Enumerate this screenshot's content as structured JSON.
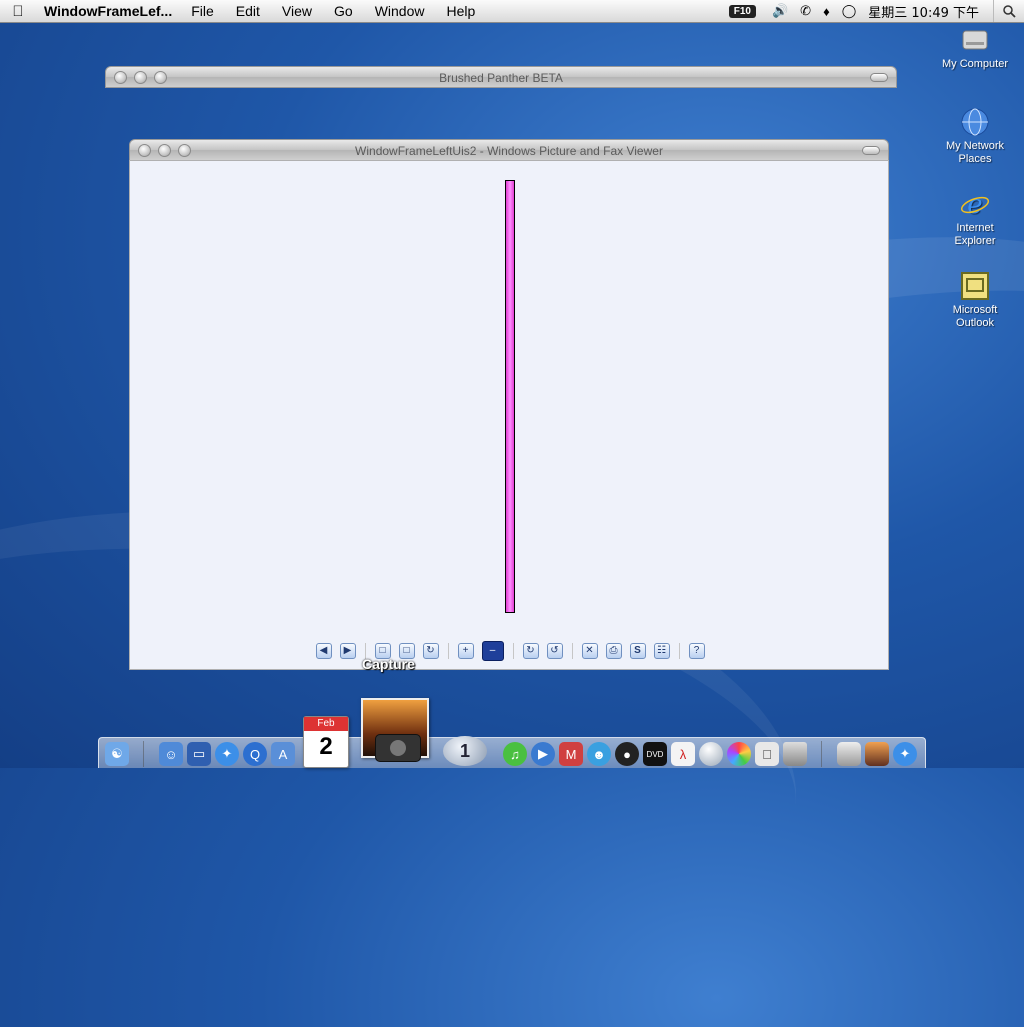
{
  "menubar": {
    "app_name": "WindowFrameLef...",
    "items": [
      "File",
      "Edit",
      "View",
      "Go",
      "Window",
      "Help"
    ],
    "f10_badge": "F10",
    "clock": "星期三 10:49 下午"
  },
  "windows": {
    "brushed_panther": {
      "title": "Brushed Panther BETA"
    },
    "viewer": {
      "title": "WindowFrameLeftUis2 - Windows Picture and Fax Viewer"
    }
  },
  "viewer_toolbar": {
    "icons": [
      "prev-image-icon",
      "next-image-icon",
      "best-fit-icon",
      "actual-size-icon",
      "slideshow-icon",
      "zoom-in-icon",
      "zoom-out-icon",
      "rotate-clockwise-icon",
      "rotate-counterclockwise-icon",
      "delete-icon",
      "print-icon",
      "save-icon",
      "open-editor-icon",
      "help-icon"
    ],
    "active": "zoom-out-icon"
  },
  "dock": {
    "hover_label": "Capture",
    "calendar_month": "Feb",
    "calendar_day": "2",
    "badge_number": "1"
  },
  "desktop_icons": [
    {
      "label": "My Computer"
    },
    {
      "label": "My Network Places"
    },
    {
      "label": "Internet Explorer"
    },
    {
      "label": "Microsoft Outlook"
    }
  ],
  "colors": {
    "desktop": "#1f57a8",
    "image_bar": "#ff66ff",
    "viewer_bg": "#eff2fa",
    "active_tool": "#1f3f9a"
  }
}
